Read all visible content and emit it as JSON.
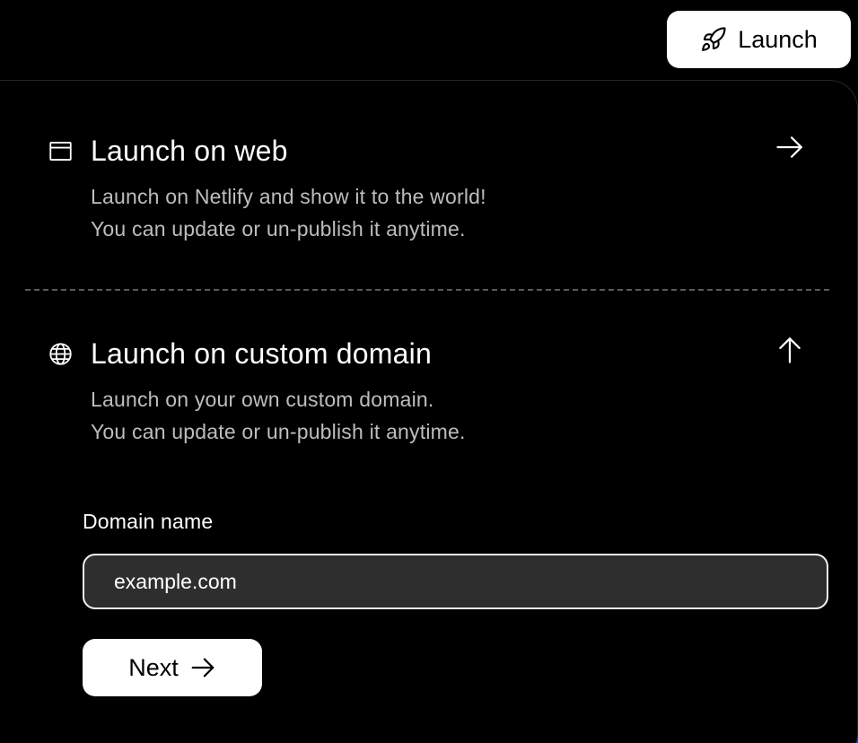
{
  "header": {
    "launch_button_label": "Launch",
    "launch_icon": "rocket-icon"
  },
  "options": [
    {
      "title": "Launch on web",
      "icon": "browser-window-icon",
      "action_icon": "arrow-right-icon",
      "description": [
        "Launch on Netlify and show it to the world!",
        "You can update or un-publish it anytime."
      ]
    },
    {
      "title": "Launch on custom domain",
      "icon": "globe-icon",
      "action_icon": "arrow-up-icon",
      "description": [
        "Launch on your own custom domain.",
        "You can update or un-publish it anytime."
      ]
    }
  ],
  "domain_form": {
    "label": "Domain name",
    "value": "example.com",
    "next_label": "Next",
    "next_icon": "arrow-right-icon"
  },
  "colors": {
    "background": "#000000",
    "button_bg": "#ffffff",
    "input_bg": "#2e2e2e",
    "accent_corner": "#2740c9"
  }
}
